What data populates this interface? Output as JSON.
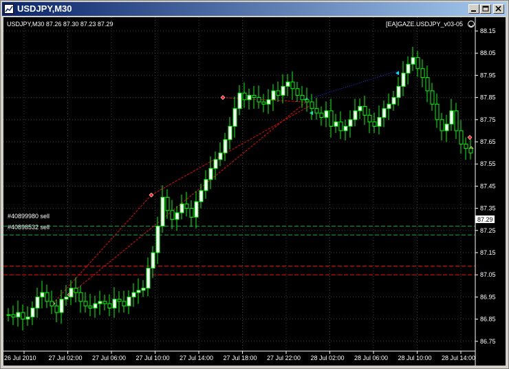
{
  "window": {
    "title": "USDJPY,M30"
  },
  "chart": {
    "symbol_info": "USDJPY,M30  87.26 87.30 87.23 87.29",
    "ea_label": "[EA]GAZE.USDJPY_v03-05",
    "current_price": "87.29",
    "order_labels": [
      "#40899980 sell",
      "#40898532 sell"
    ],
    "price_labels": [
      "88.15",
      "88.05",
      "87.95",
      "87.85",
      "87.75",
      "87.65",
      "87.55",
      "87.45",
      "87.35",
      "87.25",
      "87.15",
      "87.05",
      "86.95",
      "86.85",
      "86.75"
    ],
    "time_labels": [
      "26 Jul 2010",
      "27 Jul 02:00",
      "27 Jul 06:00",
      "27 Jul 10:00",
      "27 Jul 14:00",
      "27 Jul 18:00",
      "27 Jul 22:00",
      "28 Jul 02:00",
      "28 Jul 06:00",
      "28 Jul 10:00",
      "28 Jul 14:00"
    ],
    "colors": {
      "background": "#000000",
      "bull": "#ffffff",
      "bear": "#00ff00",
      "grid": "#3a3a3a",
      "order_line": "#00b050",
      "stop_line": "#ff0000",
      "trade_line": "#ff0000"
    }
  },
  "chart_data": {
    "type": "candlestick",
    "ylim": [
      86.72,
      88.18
    ],
    "x": [
      "26 Jul 2010",
      "27 Jul 02:00",
      "27 Jul 06:00",
      "27 Jul 10:00",
      "27 Jul 14:00",
      "27 Jul 18:00",
      "27 Jul 22:00",
      "28 Jul 02:00",
      "28 Jul 06:00",
      "28 Jul 10:00",
      "28 Jul 14:00"
    ],
    "closes": [
      86.87,
      86.86,
      86.88,
      86.85,
      86.86,
      86.9,
      86.95,
      86.97,
      86.93,
      86.91,
      86.88,
      86.94,
      86.95,
      86.99,
      86.97,
      86.93,
      86.91,
      86.9,
      86.92,
      86.93,
      86.92,
      86.9,
      86.94,
      86.93,
      86.91,
      86.95,
      86.97,
      86.98,
      86.99,
      87.08,
      87.15,
      87.27,
      87.4,
      87.34,
      87.3,
      87.33,
      87.37,
      87.35,
      87.31,
      87.38,
      87.43,
      87.48,
      87.53,
      87.57,
      87.6,
      87.66,
      87.72,
      87.8,
      87.87,
      87.84,
      87.86,
      87.85,
      87.83,
      87.82,
      87.84,
      87.88,
      87.86,
      87.9,
      87.92,
      87.89,
      87.86,
      87.84,
      87.83,
      87.8,
      87.78,
      87.76,
      87.79,
      87.72,
      87.74,
      87.7,
      87.72,
      87.75,
      87.79,
      87.81,
      87.77,
      87.74,
      87.72,
      87.76,
      87.8,
      87.82,
      87.85,
      87.9,
      87.96,
      88.0,
      88.03,
      87.98,
      87.94,
      87.88,
      87.82,
      87.75,
      87.7,
      87.73,
      87.79,
      87.7,
      87.64,
      87.62,
      87.6
    ]
  }
}
